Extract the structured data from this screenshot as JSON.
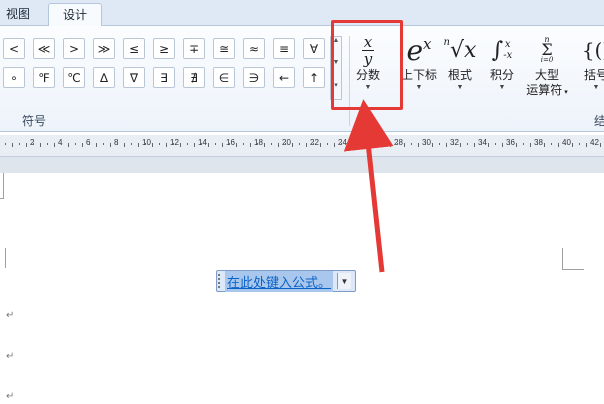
{
  "tabs": [
    {
      "label": "视图",
      "active": false
    },
    {
      "label": "设计",
      "active": true
    }
  ],
  "symbols": {
    "row1": [
      "<",
      "≪",
      ">",
      "≫",
      "≤",
      "≥",
      "∓",
      "≅",
      "≈",
      "≡",
      "∀"
    ],
    "row2": [
      "∘",
      "℉",
      "℃",
      "∆",
      "∇",
      "∃",
      "∄",
      "∈",
      "∋",
      "←",
      "↑"
    ]
  },
  "group_label": "符号",
  "corner_label": "结",
  "buttons": [
    {
      "name": "fraction",
      "label": "分数"
    },
    {
      "name": "script",
      "label": "上下标"
    },
    {
      "name": "radical",
      "label": "根式"
    },
    {
      "name": "integral",
      "label": "积分"
    },
    {
      "name": "large-operator",
      "label": "大型",
      "label2": "运算符"
    },
    {
      "name": "bracket",
      "label": "括号"
    }
  ],
  "ruler_ticks": [
    "2",
    "4",
    "6",
    "8",
    "10",
    "12",
    "14",
    "16",
    "18",
    "20",
    "22",
    "24",
    "26",
    "28",
    "30",
    "32",
    "34",
    "36",
    "38",
    "40",
    "42"
  ],
  "equation": {
    "placeholder": "在此处键入公式。"
  },
  "colors": {
    "highlight": "#e53935",
    "selection": "#a9c7ec"
  }
}
